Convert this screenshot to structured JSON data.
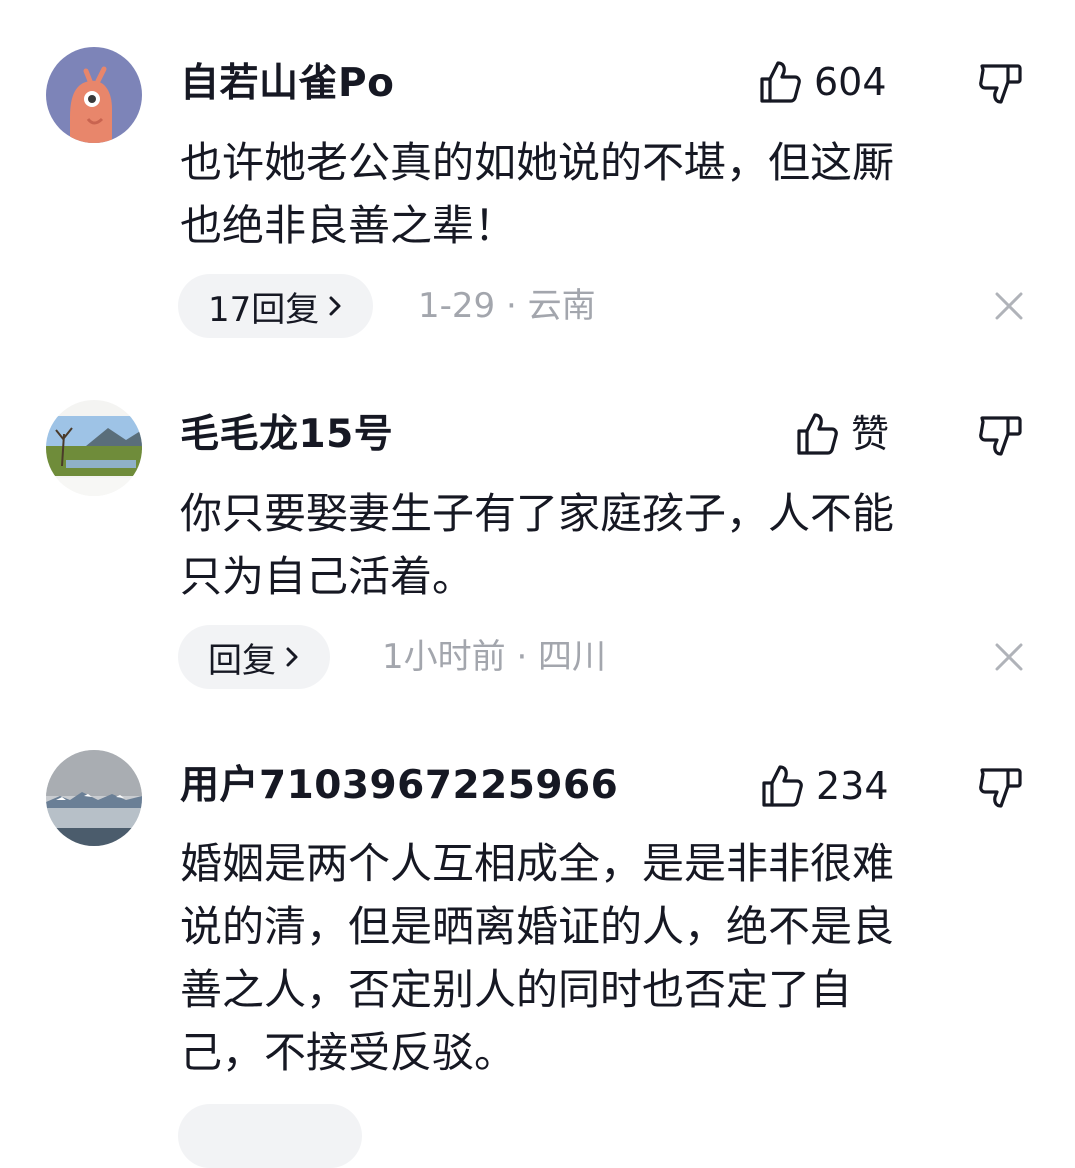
{
  "comments": [
    {
      "username": "自若山雀Po",
      "like_count": "604",
      "text_lines": [
        "也许她老公真的如她说的不堪，但这厮",
        "也绝非良善之辈！"
      ],
      "reply_label": "17回复",
      "meta": "1-29 · 云南"
    },
    {
      "username": "毛毛龙15号",
      "like_count": "赞",
      "text_lines": [
        "你只要娶妻生子有了家庭孩子，人不能",
        "只为自己活着。"
      ],
      "reply_label": "回复",
      "meta": "1小时前 · 四川"
    },
    {
      "username": "用户7103967225966",
      "like_count": "234",
      "text_lines": [
        "婚姻是两个人互相成全，是是非非很难",
        "说的清，但是晒离婚证的人，绝不是良",
        "善之人，否定别人的同时也否定了自",
        "己，不接受反驳。"
      ]
    }
  ],
  "icons": {
    "like": "thumbs-up-icon",
    "dislike": "thumbs-down-icon",
    "chevron": "chevron-right-icon",
    "close": "close-icon"
  }
}
